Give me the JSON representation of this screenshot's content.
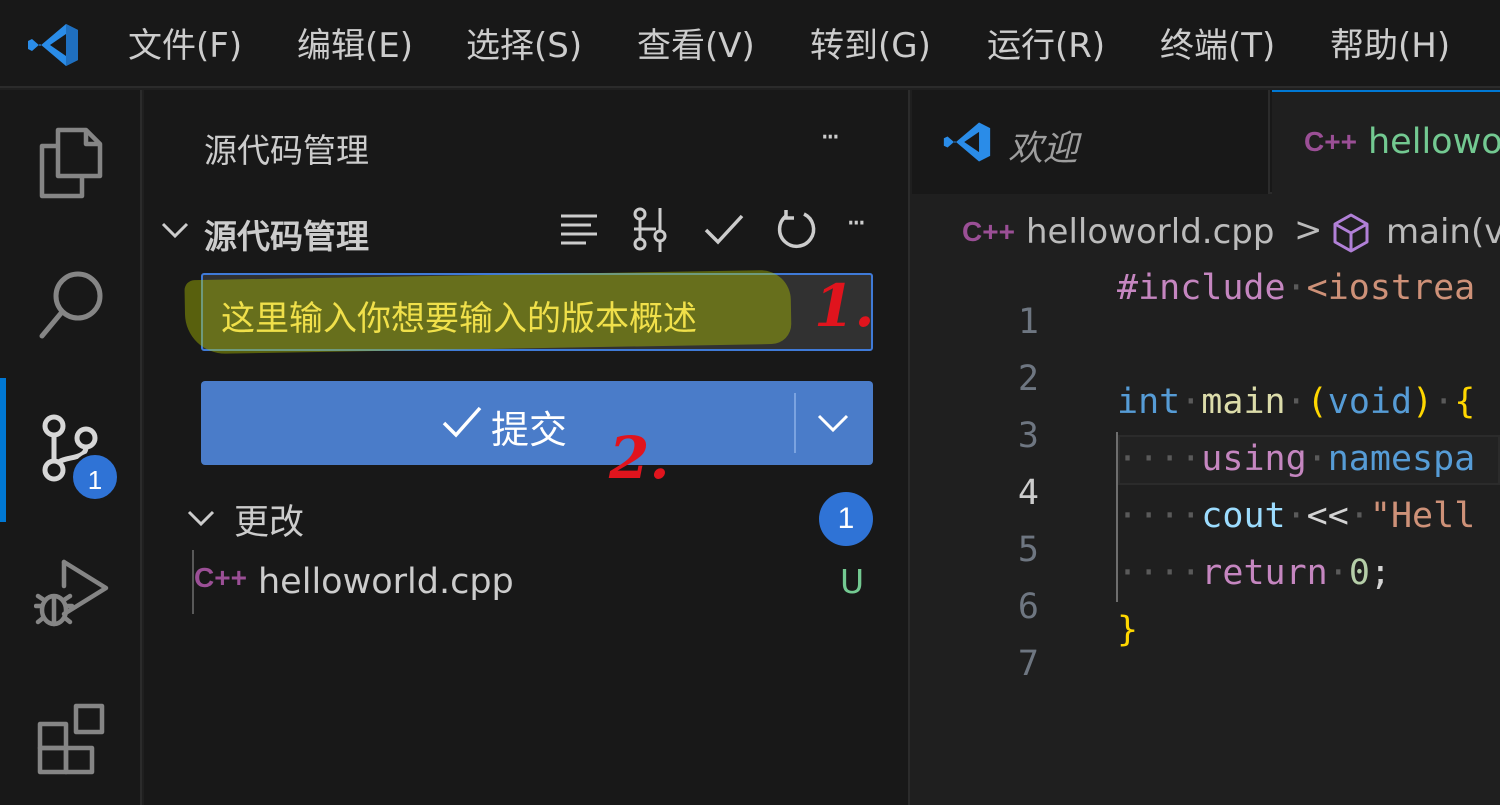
{
  "menu": {
    "items": [
      "文件(F)",
      "编辑(E)",
      "选择(S)",
      "查看(V)",
      "转到(G)",
      "运行(R)",
      "终端(T)",
      "帮助(H)"
    ]
  },
  "activity_bar": {
    "icons": [
      "explorer-icon",
      "search-icon",
      "source-control-icon",
      "run-debug-icon",
      "extensions-icon"
    ],
    "scm_badge": "1"
  },
  "sidebar": {
    "title": "源代码管理",
    "more_label": "···",
    "section": {
      "title": "源代码管理",
      "more_label": "···",
      "action_icons": [
        "view-as-list-icon",
        "source-graph-icon",
        "commit-check-icon",
        "refresh-icon"
      ]
    },
    "commit_input": {
      "value": "这里输入你想要输入的版本概述"
    },
    "commit_button": {
      "label": "提交"
    },
    "changes": {
      "title": "更改",
      "count": "1",
      "files": [
        {
          "lang_icon": "C++",
          "name": "helloworld.cpp",
          "status": "U"
        }
      ]
    },
    "annotations": [
      "1.",
      "2."
    ]
  },
  "editor": {
    "tabs": [
      {
        "label": "欢迎",
        "icon": "vscode-logo-icon"
      },
      {
        "label": "hellowo",
        "icon": "cpp-file-icon",
        "lang_icon": "C++"
      }
    ],
    "breadcrumb": {
      "lang_icon": "C++",
      "file": "helloworld.cpp",
      "separator": ">",
      "symbol": "main(v"
    },
    "code_lines": [
      {
        "n": "1",
        "text": "#include <iostrea"
      },
      {
        "n": "2",
        "text": ""
      },
      {
        "n": "3",
        "text": "int main (void) {"
      },
      {
        "n": "4",
        "text": "    using namespa"
      },
      {
        "n": "5",
        "text": "    cout << \"Hell"
      },
      {
        "n": "6",
        "text": "    return 0;"
      },
      {
        "n": "7",
        "text": "}"
      }
    ],
    "active_line": "4"
  },
  "colors": {
    "accent": "#0078d4",
    "button": "#4a7cc9",
    "badge": "#2f73d6",
    "untracked": "#73c991",
    "annotation": "#e0141d",
    "keyword_purple": "#c586c0",
    "keyword_blue": "#569cd6",
    "function_yellow": "#dcdcaa",
    "bracket_gold": "#ffd700"
  }
}
